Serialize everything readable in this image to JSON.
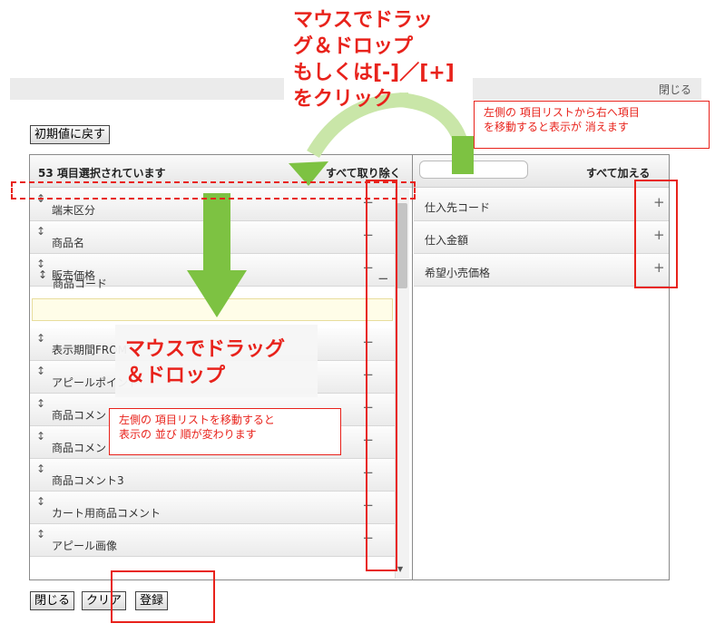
{
  "header": {
    "close_label": "閉じる"
  },
  "toolbar": {
    "reset_label": "初期値に戻す"
  },
  "left_panel": {
    "title": "53 項目選択されています",
    "remove_all_label": "すべて取り除く",
    "items": [
      {
        "label": "端末区分",
        "grip": "↕",
        "action": "−"
      },
      {
        "label": "商品名",
        "grip": "↕",
        "action": "−"
      },
      {
        "label": "商品コード",
        "grip": "↕",
        "action": "−"
      },
      {
        "label": "販売価格",
        "grip": "↕",
        "action": "−"
      },
      {
        "label": "表示期間FROM",
        "grip": "↕",
        "action": "−"
      },
      {
        "label": "アピールポイント",
        "grip": "↕",
        "action": "−"
      },
      {
        "label": "商品コメント",
        "grip": "↕",
        "action": "−"
      },
      {
        "label": "商品コメント2",
        "grip": "↕",
        "action": "−"
      },
      {
        "label": "商品コメント3",
        "grip": "↕",
        "action": "−"
      },
      {
        "label": "カート用商品コメント",
        "grip": "↕",
        "action": "−"
      },
      {
        "label": "アピール画像",
        "grip": "↕",
        "action": "−"
      }
    ]
  },
  "right_panel": {
    "search_value": "",
    "add_all_label": "すべて加える",
    "items": [
      {
        "label": "仕入先コード",
        "action": "+"
      },
      {
        "label": "仕入金額",
        "action": "+"
      },
      {
        "label": "希望小売価格",
        "action": "+"
      }
    ]
  },
  "footer": {
    "close_label": "閉じる",
    "clear_label": "クリア",
    "register_label": "登録"
  },
  "annotations": {
    "top_callout": "マウスでドラッ\nグ＆ドロップ\nもしくは[-]／[+]\nをクリック",
    "middle_callout": "マウスでドラッグ\n＆ドロップ",
    "note_right_1": "左側の 項目リストから右へ項目",
    "note_right_2": "を移動すると表示が 消えます",
    "note_left_1": "左側の 項目リストを移動すると",
    "note_left_2": "表示の 並び 順が変わります"
  },
  "colors": {
    "annotation_red": "#e8221b",
    "arrow_green": "#7dc242"
  }
}
